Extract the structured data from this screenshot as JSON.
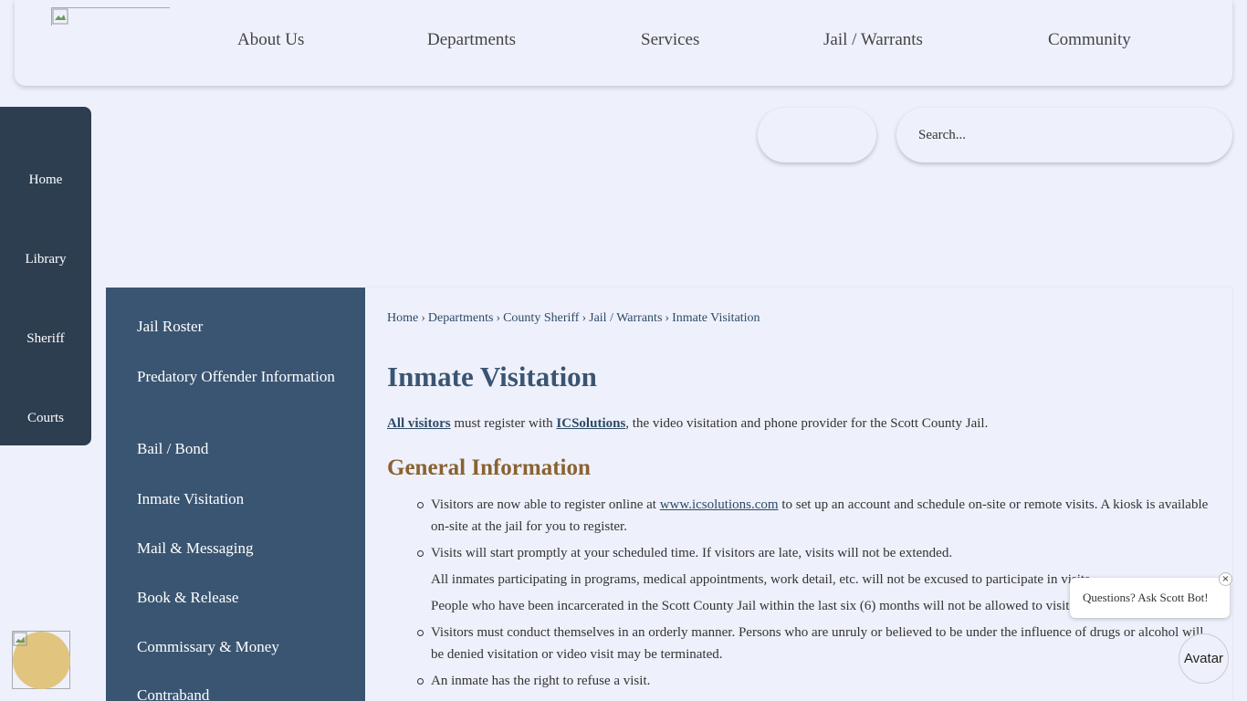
{
  "header": {
    "nav": [
      "About Us",
      "Departments",
      "Services",
      "Jail / Warrants",
      "Community"
    ]
  },
  "sidebar": {
    "items": [
      "Home",
      "Library",
      "Sheriff",
      "Courts"
    ]
  },
  "search": {
    "placeholder": "Search..."
  },
  "section_nav": {
    "items": [
      "Jail Roster",
      "Predatory Offender Information",
      "Bail / Bond",
      "Inmate Visitation",
      "Mail & Messaging",
      "Book & Release",
      "Commissary & Money",
      "Contraband"
    ]
  },
  "breadcrumb": [
    "Home",
    "Departments",
    "County Sheriff",
    "Jail / Warrants",
    "Inmate Visitation"
  ],
  "page": {
    "title": "Inmate Visitation",
    "intro_link1": "All visitors",
    "intro_text1": " must register with ",
    "intro_link2": "ICSolutions",
    "intro_text2": ", the video visitation and phone provider for the Scott County Jail.",
    "section_heading": "General Information",
    "bullet1_pre": "Visitors are now able to register online at ",
    "bullet1_link": "www.icsolutions.com",
    "bullet1_post": " to set up an account and schedule on-site or remote visits.  A kiosk is available on-site at the jail for you to register.",
    "bullet2": "Visits will start promptly at your scheduled time.  If visitors are late, visits will not be extended.",
    "bullet3": "All inmates participating in programs, medical appointments, work detail, etc. will not be excused to participate in visits.",
    "bullet4": "People who have been incarcerated in the Scott County Jail within the last six (6) months will not be allowed to visit.",
    "bullet5": "Visitors must conduct themselves in an orderly manner. Persons who are unruly or believed to be under the influence of drugs or alcohol will be denied visitation or video visit may be terminated.",
    "bullet6": "An inmate has the right to refuse a visit."
  },
  "chatbot": {
    "prompt": "Questions? Ask Scott Bot!",
    "close": "×",
    "avatar_label": "Avatar"
  },
  "colors": {
    "sidebar": "#2d3e50",
    "section_nav": "#3a5572",
    "heading": "#3a5572",
    "subheading": "#8a6231",
    "page_bg": "#eef1fb",
    "widget": "#e1c57f"
  }
}
